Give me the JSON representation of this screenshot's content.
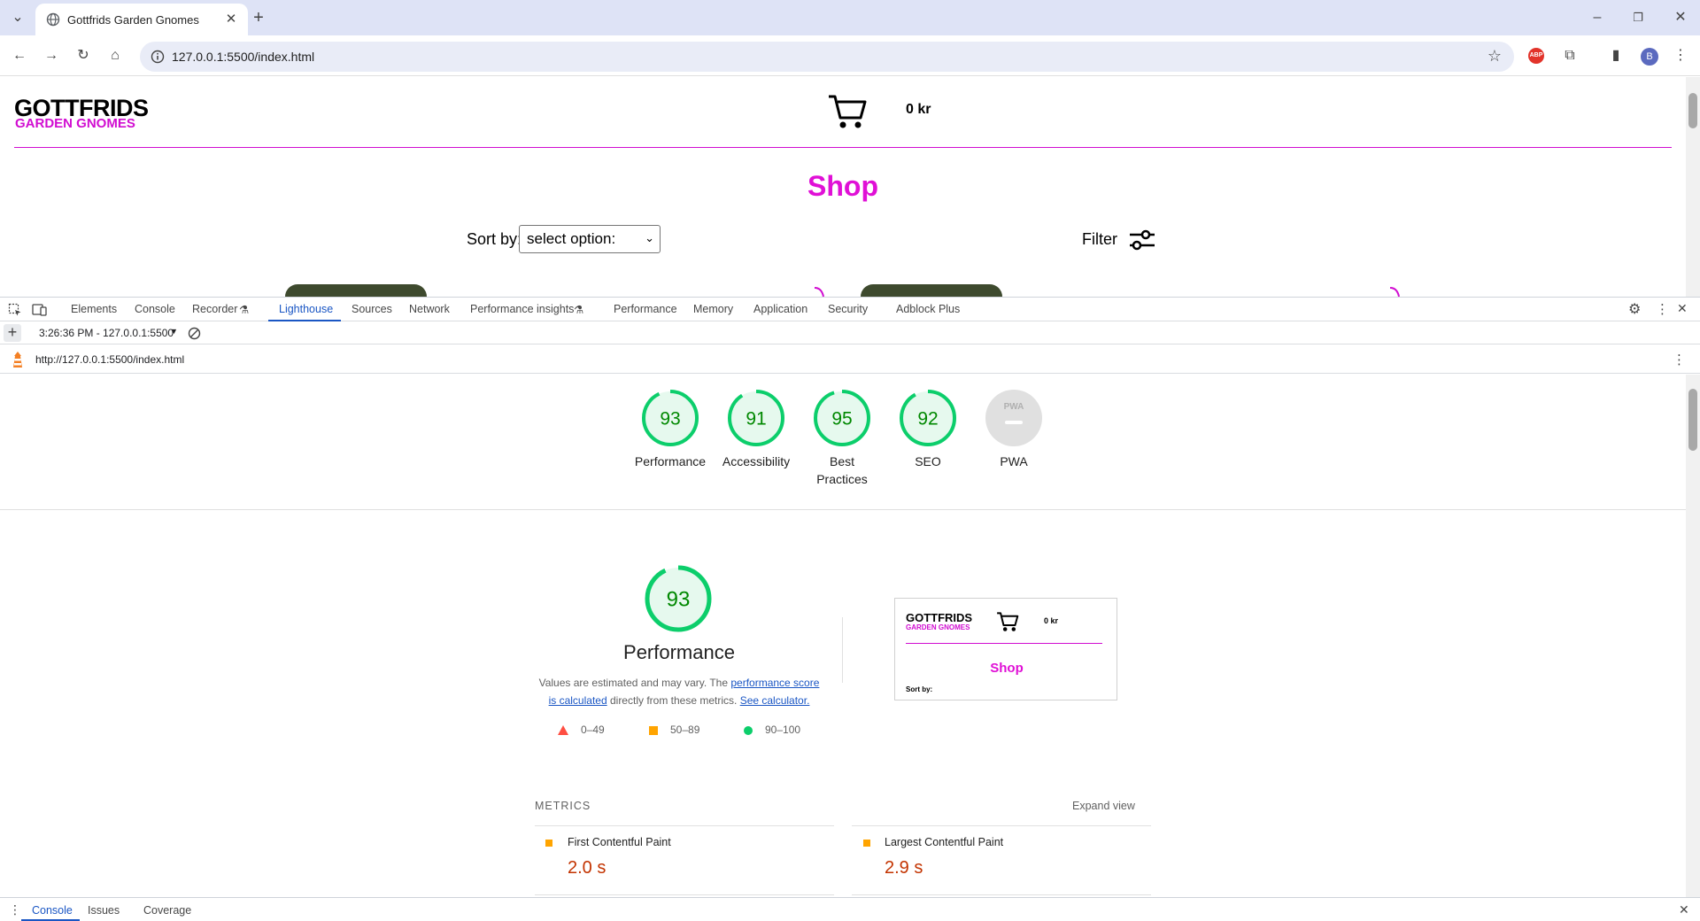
{
  "browser": {
    "tab_title": "Gottfrids Garden Gnomes",
    "url": "127.0.0.1:5500/index.html"
  },
  "site": {
    "logo_top": "GOTTFRIDS",
    "logo_bottom": "GARDEN GNOMES",
    "cart_total": "0 kr",
    "shop_title": "Shop",
    "sort_label": "Sort by:",
    "sort_value": "select option:",
    "filter_label": "Filter"
  },
  "devtools": {
    "tabs": [
      "Elements",
      "Console",
      "Recorder",
      "Lighthouse",
      "Sources",
      "Network",
      "Performance insights",
      "Performance",
      "Memory",
      "Application",
      "Security",
      "Adblock Plus"
    ],
    "active_tab": "Lighthouse",
    "report_selector": "3:26:36 PM - 127.0.0.1:5500",
    "report_url": "http://127.0.0.1:5500/index.html",
    "drawer_tabs": [
      "Console",
      "Issues",
      "Coverage"
    ],
    "active_drawer_tab": "Console"
  },
  "lighthouse": {
    "scores": [
      {
        "label": "Performance",
        "value": 93
      },
      {
        "label": "Accessibility",
        "value": 91
      },
      {
        "label": "Best Practices",
        "value": 95
      },
      {
        "label": "SEO",
        "value": 92
      },
      {
        "label": "PWA",
        "value": null
      }
    ],
    "pwa_badge": "PWA",
    "perf_score": 93,
    "perf_title": "Performance",
    "perf_desc_1": "Values are estimated and may vary. The ",
    "perf_desc_link1": "performance score is calculated",
    "perf_desc_2": " directly from these metrics. ",
    "perf_desc_link2": "See calculator.",
    "legend": [
      "0–49",
      "50–89",
      "90–100"
    ],
    "colors": {
      "pass": "#0cce6b",
      "pass_text": "#008800",
      "average": "#ffa400",
      "fail": "#ff4e42"
    },
    "thumb": {
      "logo_top": "GOTTFRIDS",
      "logo_bottom": "GARDEN GNOMES",
      "cart": "0 kr",
      "shop": "Shop",
      "sort": "Sort by:"
    },
    "metrics_header": "METRICS",
    "expand_view": "Expand view",
    "metrics": [
      {
        "name": "First Contentful Paint",
        "value": "2.0 s"
      },
      {
        "name": "Largest Contentful Paint",
        "value": "2.9 s"
      }
    ]
  }
}
